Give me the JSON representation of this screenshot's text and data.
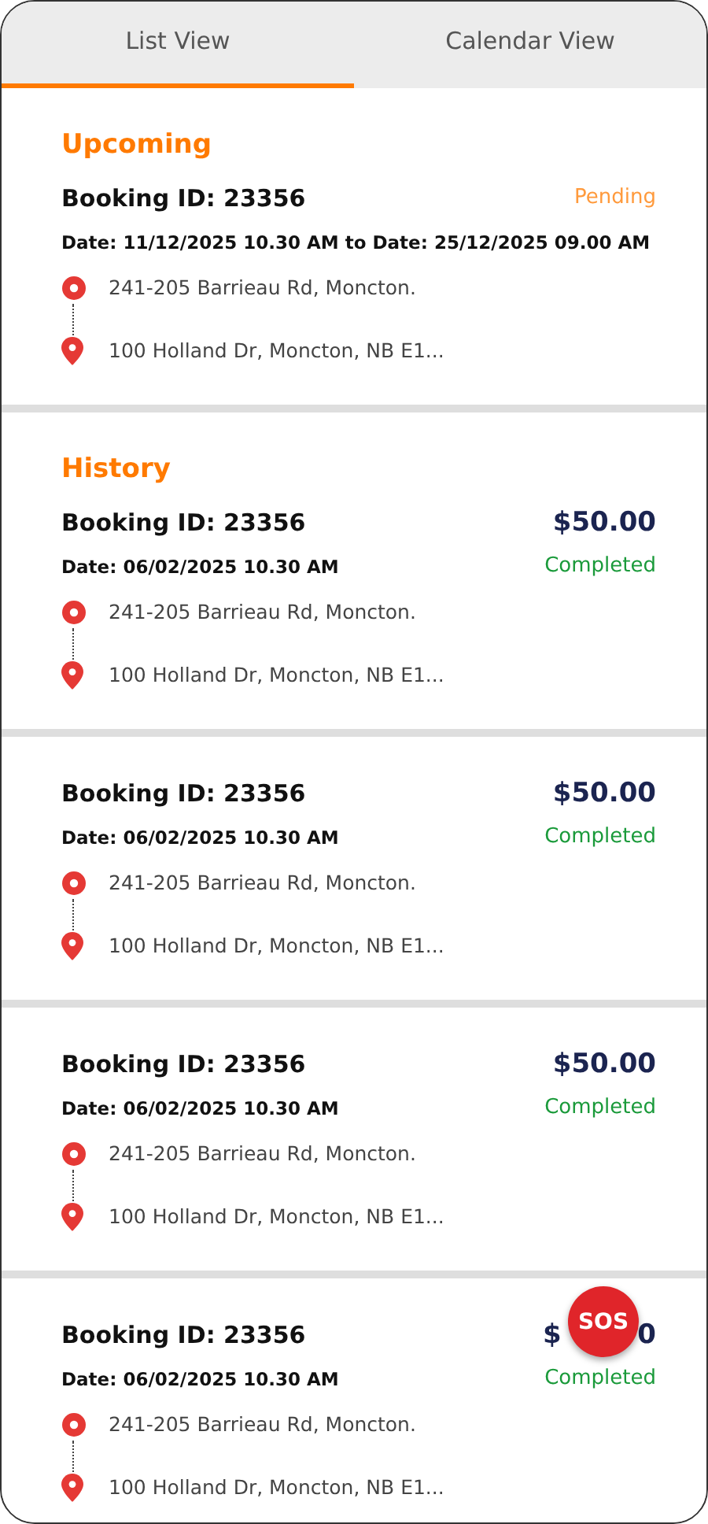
{
  "tabs": [
    {
      "label": "List View",
      "selected": true
    },
    {
      "label": "Calendar View",
      "selected": false
    }
  ],
  "cards": [
    {
      "section_title": "Upcoming",
      "booking_id": "Booking ID: 23356",
      "status": "Pending",
      "kind": "pending",
      "date": "Date: 11/12/2025 10.30 AM to Date: 25/12/2025 09.00 AM",
      "pickup": "241-205 Barrieau Rd, Moncton.",
      "dropoff": "100 Holland Dr, Moncton, NB E1..."
    },
    {
      "section_title": "History",
      "booking_id": "Booking ID: 23356",
      "price": "$50.00",
      "status": "Completed",
      "kind": "completed",
      "date": "Date: 06/02/2025 10.30 AM",
      "pickup": "241-205 Barrieau Rd, Moncton.",
      "dropoff": "100 Holland Dr, Moncton, NB E1..."
    },
    {
      "booking_id": "Booking ID: 23356",
      "price": "$50.00",
      "status": "Completed",
      "kind": "completed",
      "date": "Date: 06/02/2025 10.30 AM",
      "pickup": "241-205 Barrieau Rd, Moncton.",
      "dropoff": "100 Holland Dr, Moncton, NB E1..."
    },
    {
      "booking_id": "Booking ID: 23356",
      "price": "$50.00",
      "status": "Completed",
      "kind": "completed",
      "date": "Date: 06/02/2025 10.30 AM",
      "pickup": "241-205 Barrieau Rd, Moncton.",
      "dropoff": "100 Holland Dr, Moncton, NB E1..."
    },
    {
      "booking_id": "Booking ID: 23356",
      "price_fragments": [
        "$",
        "0"
      ],
      "status": "Completed",
      "kind": "completed",
      "date": "Date: 06/02/2025 10.30 AM",
      "pickup": "241-205 Barrieau Rd, Moncton.",
      "dropoff": "100 Holland Dr, Moncton, NB E1..."
    }
  ],
  "sos_button": {
    "label": "SOS"
  }
}
